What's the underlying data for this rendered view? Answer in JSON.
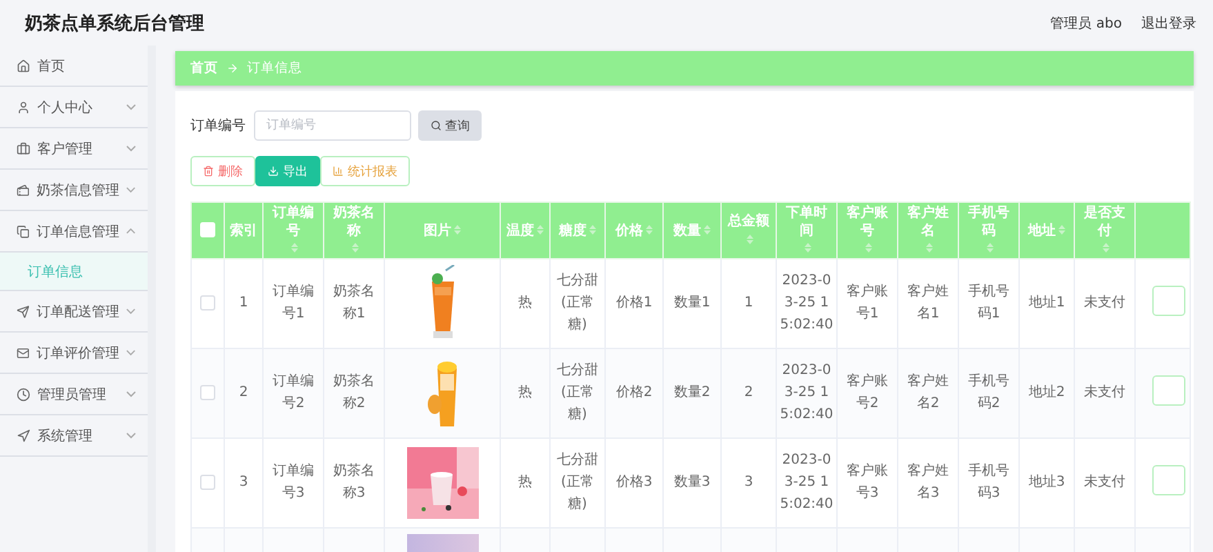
{
  "header": {
    "title": "奶茶点单系统后台管理",
    "user": "管理员 abo",
    "logout": "退出登录"
  },
  "sidebar": {
    "items": [
      {
        "label": "首页",
        "kind": "link"
      },
      {
        "label": "个人中心",
        "kind": "menu",
        "expanded": false
      },
      {
        "label": "客户管理",
        "kind": "menu",
        "expanded": false
      },
      {
        "label": "奶茶信息管理",
        "kind": "menu",
        "expanded": false
      },
      {
        "label": "订单信息管理",
        "kind": "menu",
        "expanded": true,
        "children": [
          {
            "label": "订单信息",
            "selected": true
          }
        ]
      },
      {
        "label": "订单配送管理",
        "kind": "menu",
        "expanded": false
      },
      {
        "label": "订单评价管理",
        "kind": "menu",
        "expanded": false
      },
      {
        "label": "管理员管理",
        "kind": "menu",
        "expanded": false
      },
      {
        "label": "系统管理",
        "kind": "menu",
        "expanded": false
      }
    ]
  },
  "breadcrumb": [
    {
      "label": "首页",
      "selected": false
    },
    {
      "label": "订单信息",
      "selected": true
    }
  ],
  "search": {
    "label": "订单编号",
    "placeholder": "订单编号",
    "button": "查询"
  },
  "actions": [
    {
      "kind": "delete",
      "label": "删除"
    },
    {
      "kind": "export",
      "label": "导出"
    },
    {
      "kind": "report",
      "label": "统计报表"
    }
  ],
  "table": {
    "select_all": {
      "checked": false
    },
    "columns": [
      {
        "label": "索引",
        "sortable": false
      },
      {
        "label": "订单编号",
        "sortable": true
      },
      {
        "label": "奶茶名称",
        "sortable": true
      },
      {
        "label": "图片",
        "sortable": true
      },
      {
        "label": "温度",
        "sortable": true
      },
      {
        "label": "糖度",
        "sortable": true
      },
      {
        "label": "价格",
        "sortable": true
      },
      {
        "label": "数量",
        "sortable": true
      },
      {
        "label": "总金额",
        "sortable": true
      },
      {
        "label": "下单时间",
        "sortable": true
      },
      {
        "label": "客户账号",
        "sortable": true
      },
      {
        "label": "客户姓名",
        "sortable": true
      },
      {
        "label": "手机号码",
        "sortable": true
      },
      {
        "label": "地址",
        "sortable": true
      },
      {
        "label": "是否支付",
        "sortable": true
      }
    ],
    "rows": [
      {
        "kind": "full",
        "checked": false,
        "cells": [
          "1",
          "订单编号1",
          "奶茶名称1",
          null,
          "热",
          "七分甜(正常糖)",
          "价格1",
          "数量1",
          "1",
          "2023-03-25 15:02:40",
          "客户账号1",
          "客户姓名1",
          "手机号码1",
          "地址1",
          "未支付"
        ]
      },
      {
        "kind": "full",
        "checked": false,
        "cells": [
          "2",
          "订单编号2",
          "奶茶名称2",
          null,
          "热",
          "七分甜(正常糖)",
          "价格2",
          "数量2",
          "2",
          "2023-03-25 15:02:40",
          "客户账号2",
          "客户姓名2",
          "手机号码2",
          "地址2",
          "未支付"
        ]
      },
      {
        "kind": "full",
        "checked": false,
        "cells": [
          "3",
          "订单编号3",
          "奶茶名称3",
          null,
          "热",
          "七分甜(正常糖)",
          "价格3",
          "数量3",
          "3",
          "2023-03-25 15:02:40",
          "客户账号3",
          "客户姓名3",
          "手机号码3",
          "地址3",
          "未支付"
        ]
      },
      {
        "kind": "cut"
      }
    ]
  }
}
